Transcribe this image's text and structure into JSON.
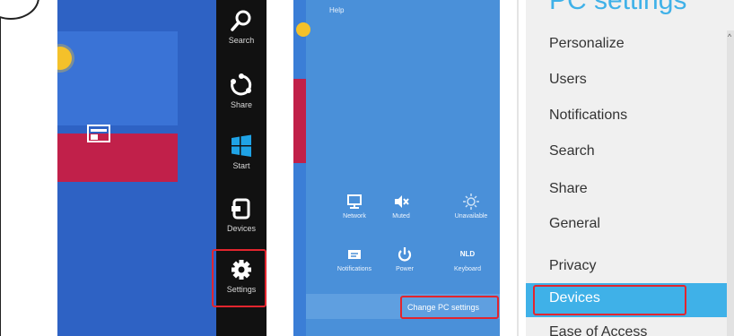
{
  "charms": {
    "search": "Search",
    "share": "Share",
    "start": "Start",
    "devices": "Devices",
    "settings": "Settings"
  },
  "settings_pane": {
    "help": "Help",
    "quick_settings": {
      "network": "Network",
      "muted": "Muted",
      "unavailable": "Unavailable",
      "notifications": "Notifications",
      "power": "Power",
      "keyboard": "Keyboard",
      "keyboard_code": "NLD"
    },
    "change_pc_settings": "Change PC settings"
  },
  "pc_settings": {
    "title": "PC settings",
    "items": [
      "Personalize",
      "Users",
      "Notifications",
      "Search",
      "Share",
      "General",
      "Privacy",
      "Devices",
      "Ease of Access"
    ],
    "selected": "Devices"
  },
  "colors": {
    "highlight_box": "#e2252e",
    "pc_accent": "#3fb1e8",
    "charms_bar": "#111111",
    "settings_pane": "#4a90d9"
  }
}
